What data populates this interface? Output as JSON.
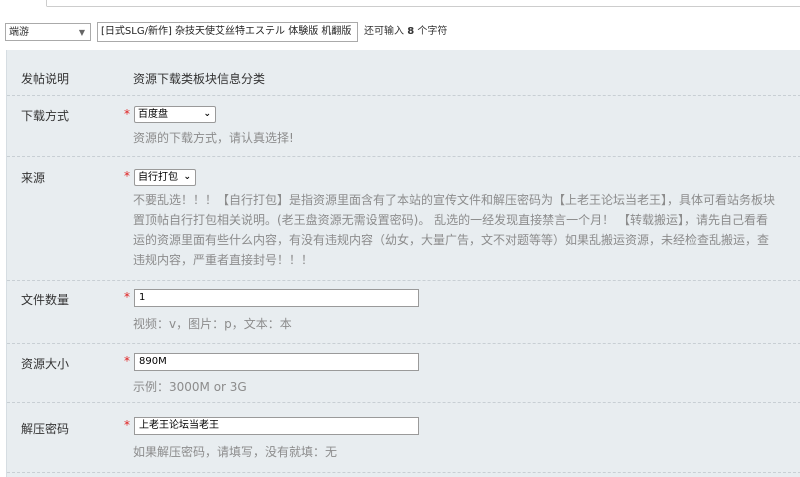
{
  "header": {
    "type_select": {
      "value": "端游"
    },
    "title_input": {
      "value": "[日式SLG/新作] 杂技天使艾丝特エステル 体験版 机翻版"
    },
    "char_hint": {
      "prefix": "还可输入",
      "count": "8",
      "suffix": "个字符"
    }
  },
  "form": {
    "instructions": {
      "label": "发帖说明",
      "text": "资源下载类板块信息分类"
    },
    "download_method": {
      "label": "下载方式",
      "required": "*",
      "selected": "百度盘",
      "hint": "资源的下载方式，请认真选择!"
    },
    "source": {
      "label": "来源",
      "required": "*",
      "selected": "自行打包",
      "hint_lines": [
        "不要乱选！！！【自行打包】是指资源里面含有了本站的宣传文件和解压密码为【上老王论坛当老王】，具体可看站务板块",
        "置顶帖自行打包相关说明。(老王盘资源无需设置密码)。 乱选的一经发现直接禁言一个月！ 【转载搬运】，请先自己看看",
        "运的资源里面有些什么内容，有没有违规内容（幼女，大量广告，文不对题等等）如果乱搬运资源，未经检查乱搬运，查",
        "违规内容，严重者直接封号！！！"
      ]
    },
    "file_count": {
      "label": "文件数量",
      "required": "*",
      "value": "1",
      "hint": "视频：v，图片：p，文本：本"
    },
    "resource_size": {
      "label": "资源大小",
      "required": "*",
      "value": "890M",
      "hint": "示例：3000M or 3G"
    },
    "password": {
      "label": "解压密码",
      "required": "*",
      "value": "上老王论坛当老王",
      "hint": "如果解压密码，请填写，没有就填：无"
    }
  }
}
